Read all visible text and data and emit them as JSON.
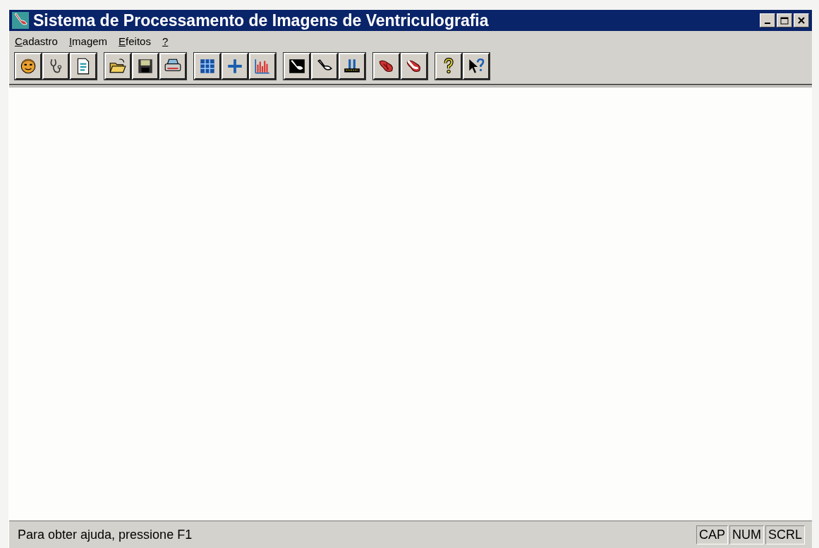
{
  "window": {
    "title": "Sistema de Processamento de Imagens de Ventriculografia"
  },
  "menu": [
    {
      "label": "Cadastro"
    },
    {
      "label": "Imagem"
    },
    {
      "label": "Efeitos"
    },
    {
      "label": "?"
    }
  ],
  "toolbar": [
    {
      "buttons": [
        {
          "kind": "face"
        },
        {
          "kind": "stethoscope"
        },
        {
          "kind": "document"
        }
      ]
    },
    {
      "buttons": [
        {
          "kind": "folder"
        },
        {
          "kind": "floppy"
        },
        {
          "kind": "printer"
        }
      ]
    },
    {
      "buttons": [
        {
          "kind": "grid"
        },
        {
          "kind": "plus"
        },
        {
          "kind": "histogram"
        }
      ]
    },
    {
      "buttons": [
        {
          "kind": "ventricle-dark"
        },
        {
          "kind": "ventricle-outline"
        },
        {
          "kind": "bars"
        }
      ]
    },
    {
      "buttons": [
        {
          "kind": "ventricle-red"
        },
        {
          "kind": "ventricle-red-outline"
        }
      ]
    },
    {
      "buttons": [
        {
          "kind": "help"
        },
        {
          "kind": "pointer-help"
        }
      ]
    }
  ],
  "status_bar": {
    "message": "Para obter ajuda, pressione F1",
    "indicators": [
      "CAP",
      "NUM",
      "SCRL"
    ]
  }
}
